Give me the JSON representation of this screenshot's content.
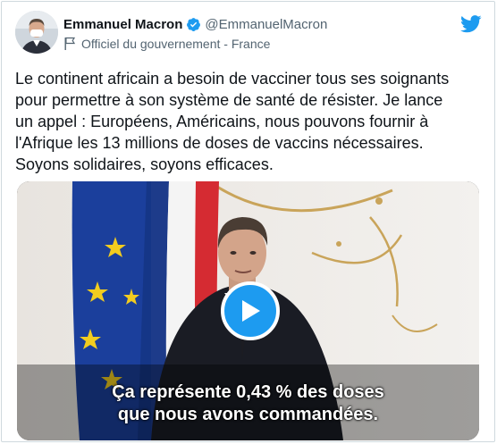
{
  "author": {
    "display_name": "Emmanuel Macron",
    "handle": "@EmmanuelMacron",
    "affiliation": "Officiel du gouvernement - France",
    "avatar_icon": "profile-photo",
    "verified_icon": "verified-badge-icon",
    "affiliation_icon": "flag-icon"
  },
  "brand": {
    "logo_icon": "twitter-bird-icon",
    "accent_color": "#1d9bf0"
  },
  "tweet": {
    "text": "Le continent africain a besoin de vacciner tous ses soignants\npour permettre à son système de santé de résister. Je lance\nun appel : Européens, Américains, nous pouvons fournir à\nl'Afrique les 13 millions de doses de vaccins nécessaires.\nSoyons solidaires, soyons efficaces."
  },
  "video": {
    "subtitle_line1": "Ça représente 0,43 % des doses",
    "subtitle_line2": "que nous avons commandées.",
    "play_icon": "play-icon"
  }
}
